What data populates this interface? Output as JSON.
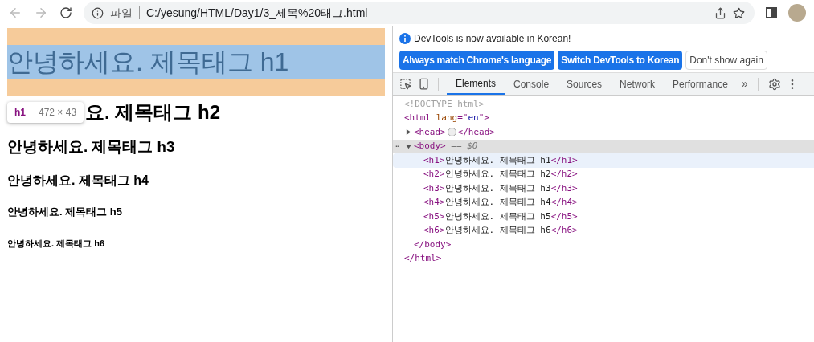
{
  "browser": {
    "scheme_label": "파일",
    "url": "C:/yesung/HTML/Day1/3_제목%20태그.html"
  },
  "page": {
    "headings": [
      {
        "kind": "h1",
        "text": "안녕하세요. 제목태그 h1",
        "inspected": true,
        "under_tooltip": false
      },
      {
        "kind": "h2",
        "text": "요. 제목태그 h2",
        "inspected": false,
        "under_tooltip": true
      },
      {
        "kind": "h3",
        "text": "안녕하세요. 제목태그 h3",
        "inspected": false,
        "under_tooltip": false
      },
      {
        "kind": "h4",
        "text": "안녕하세요. 제목태그 h4",
        "inspected": false,
        "under_tooltip": false
      },
      {
        "kind": "h5",
        "text": "안녕하세요. 제목태그 h5",
        "inspected": false,
        "under_tooltip": false
      },
      {
        "kind": "h6",
        "text": "안녕하세요. 제목태그 h6",
        "inspected": false,
        "under_tooltip": false
      }
    ],
    "tooltip": {
      "tag": "h1",
      "size": "472 × 43"
    }
  },
  "devtools": {
    "banner": {
      "message": "DevTools is now available in Korean!",
      "buttons": [
        {
          "label": "Always match Chrome's language",
          "kind": "primary"
        },
        {
          "label": "Switch DevTools to Korean",
          "kind": "primary"
        },
        {
          "label": "Don't show again",
          "kind": "secondary"
        }
      ]
    },
    "tabs": [
      {
        "label": "Elements",
        "selected": true
      },
      {
        "label": "Console",
        "selected": false
      },
      {
        "label": "Sources",
        "selected": false
      },
      {
        "label": "Network",
        "selected": false
      },
      {
        "label": "Performance",
        "selected": false
      }
    ],
    "more_tabs": "»",
    "dom": [
      {
        "parts": [
          {
            "kind": "comment",
            "text": "<!DOCTYPE html>"
          }
        ],
        "selected": false,
        "hovered": false
      },
      {
        "parts": [
          {
            "kind": "tag",
            "text": "<html"
          },
          {
            "kind": "attr",
            "text": " lang"
          },
          {
            "kind": "tag",
            "text": "=\""
          },
          {
            "kind": "value",
            "text": "en"
          },
          {
            "kind": "tag",
            "text": "\">"
          }
        ],
        "close": [
          {
            "kind": "tag",
            "text": "</html>"
          }
        ],
        "selected": false,
        "hovered": false,
        "children": [
          {
            "parts": [
              {
                "kind": "tag",
                "text": "<head>"
              },
              {
                "kind": "ellipsis",
                "text": "⋯"
              },
              {
                "kind": "tag",
                "text": "</head>"
              }
            ],
            "expanded": false,
            "selected": false,
            "hovered": false
          },
          {
            "parts": [
              {
                "kind": "tag",
                "text": "<body>"
              },
              {
                "kind": "note",
                "text": " == $0"
              }
            ],
            "close": [
              {
                "kind": "tag",
                "text": "</body>"
              }
            ],
            "gutter_mark": "⋯",
            "expanded": true,
            "selected": true,
            "hovered": false,
            "children": [
              {
                "parts": [
                  {
                    "kind": "tag",
                    "text": "<h1>"
                  },
                  {
                    "kind": "text",
                    "text": "안녕하세요. 제목태그 h1"
                  },
                  {
                    "kind": "tag",
                    "text": "</h1>"
                  }
                ],
                "selected": false,
                "hovered": true
              },
              {
                "parts": [
                  {
                    "kind": "tag",
                    "text": "<h2>"
                  },
                  {
                    "kind": "text",
                    "text": "안녕하세요. 제목태그 h2"
                  },
                  {
                    "kind": "tag",
                    "text": "</h2>"
                  }
                ],
                "selected": false,
                "hovered": false
              },
              {
                "parts": [
                  {
                    "kind": "tag",
                    "text": "<h3>"
                  },
                  {
                    "kind": "text",
                    "text": "안녕하세요. 제목태그 h3"
                  },
                  {
                    "kind": "tag",
                    "text": "</h3>"
                  }
                ],
                "selected": false,
                "hovered": false
              },
              {
                "parts": [
                  {
                    "kind": "tag",
                    "text": "<h4>"
                  },
                  {
                    "kind": "text",
                    "text": "안녕하세요. 제목태그 h4"
                  },
                  {
                    "kind": "tag",
                    "text": "</h4>"
                  }
                ],
                "selected": false,
                "hovered": false
              },
              {
                "parts": [
                  {
                    "kind": "tag",
                    "text": "<h5>"
                  },
                  {
                    "kind": "text",
                    "text": "안녕하세요. 제목태그 h5"
                  },
                  {
                    "kind": "tag",
                    "text": "</h5>"
                  }
                ],
                "selected": false,
                "hovered": false
              },
              {
                "parts": [
                  {
                    "kind": "tag",
                    "text": "<h6>"
                  },
                  {
                    "kind": "text",
                    "text": "안녕하세요. 제목태그 h6"
                  },
                  {
                    "kind": "tag",
                    "text": "</h6>"
                  }
                ],
                "selected": false,
                "hovered": false
              }
            ]
          }
        ]
      }
    ]
  }
}
